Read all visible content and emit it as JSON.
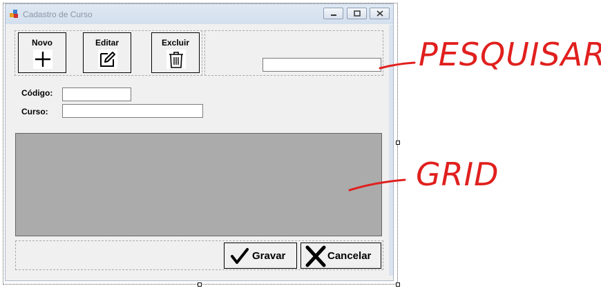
{
  "window": {
    "title": "Cadastro de Curso",
    "controls": [
      "minimize-icon",
      "maximize-icon",
      "close-icon"
    ]
  },
  "toolbar": {
    "buttons": [
      {
        "label": "Novo",
        "icon": "plus-icon"
      },
      {
        "label": "Editar",
        "icon": "edit-icon"
      },
      {
        "label": "Excluir",
        "icon": "trash-icon"
      }
    ]
  },
  "search": {
    "value": ""
  },
  "form": {
    "codigo_label": "Código:",
    "codigo_value": "",
    "curso_label": "Curso:",
    "curso_value": ""
  },
  "actions": {
    "save_label": "Gravar",
    "save_icon": "checkmark-icon",
    "cancel_label": "Cancelar",
    "cancel_icon": "x-icon"
  },
  "annotations": {
    "search": "PESQUISAR",
    "grid": "GRID"
  },
  "colors": {
    "annotation": "#e0201e",
    "grid_background": "#ababab",
    "window_background": "#f0f0f0"
  }
}
